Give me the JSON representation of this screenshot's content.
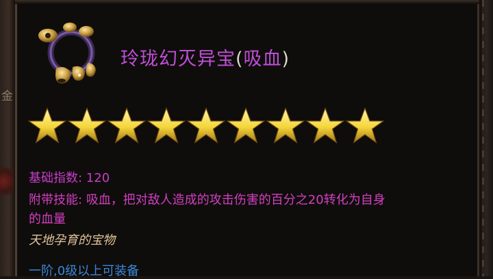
{
  "background": {
    "left_glyph": "金"
  },
  "item": {
    "icon": "bracelet-icon",
    "name": "玲珑幻灭异宝",
    "paren_open": "(",
    "subtype": "吸血",
    "paren_close": ")",
    "stars": 9,
    "base_index_label": "基础指数: 120",
    "skill_line1": "附带技能: 吸血，把对敌人造成的攻击伤害的百分之20转化为自身",
    "skill_line2": "的血量",
    "flavor": "天地孕育的宝物",
    "requirement": "一阶,0级以上可装备"
  },
  "colors": {
    "name": "#c04fd8",
    "stats": "#c63ec8",
    "flavor": "#e0c49a",
    "requirement": "#3b87d8",
    "star": "#f4d63a"
  }
}
